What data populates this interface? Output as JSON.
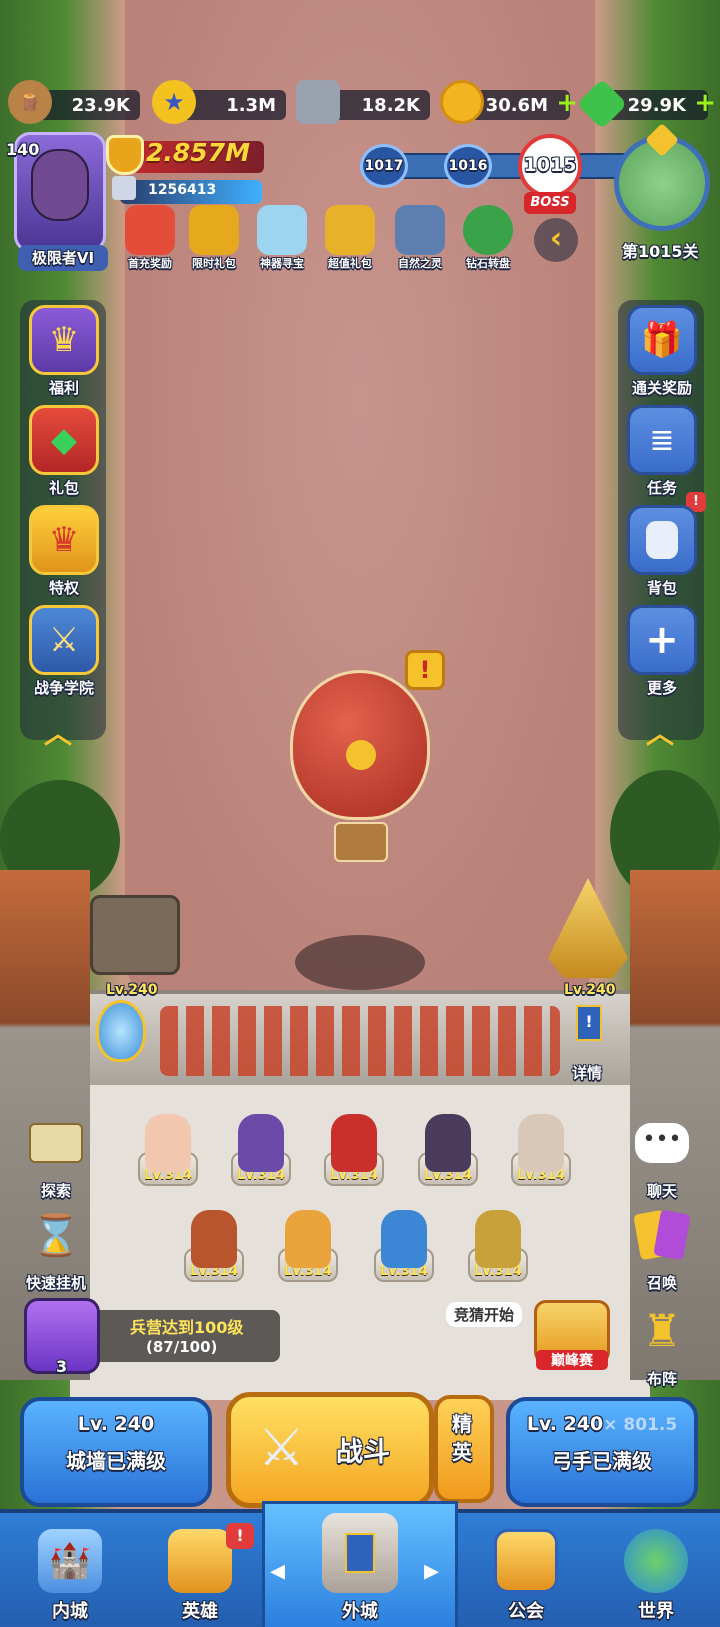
{
  "resources": [
    {
      "id": "wood",
      "value": "23.9K",
      "icon": "wood-log-icon",
      "color": "#b98246"
    },
    {
      "id": "medal",
      "value": "1.3M",
      "icon": "star-medal-icon",
      "color": "#f3c21f"
    },
    {
      "id": "iron",
      "value": "18.2K",
      "icon": "iron-ingot-icon",
      "color": "#9aa2b0"
    },
    {
      "id": "gold",
      "value": "30.6M",
      "icon": "gold-coin-icon",
      "color": "#f2b521"
    },
    {
      "id": "gem",
      "value": "29.9K",
      "icon": "green-gem-icon",
      "color": "#3fc24a"
    }
  ],
  "player": {
    "level": "140",
    "rank": "极限者VI",
    "power": "2.857M",
    "id": "1256413"
  },
  "stages": {
    "prev2": "1017",
    "prev1": "1016",
    "current": "1015",
    "boss": "BOSS",
    "stage_label": "第1015关"
  },
  "events": [
    "首充奖励",
    "限时礼包",
    "神器寻宝",
    "超值礼包",
    "自然之灵",
    "钻石转盘"
  ],
  "left_menu": [
    "福利",
    "礼包",
    "特权",
    "战争学院"
  ],
  "right_menu": [
    "通关奖励",
    "任务",
    "背包",
    "更多"
  ],
  "castle": {
    "left_tower_level": "Lv.240",
    "right_tower_level": "Lv.240",
    "details": "详情"
  },
  "heroes": [
    "Lv.314",
    "Lv.314",
    "Lv.314",
    "Lv.314",
    "Lv.314",
    "Lv.314",
    "Lv.314",
    "Lv.314",
    "Lv.314"
  ],
  "side_actions": {
    "explore": "探索",
    "quick_idle": "快速挂机",
    "chat": "聊天",
    "summon": "召唤",
    "formation": "布阵"
  },
  "barracks": {
    "text": "兵营达到100级",
    "progress": "(87/100)",
    "gift_count": "3"
  },
  "quiz": "竞猜开始",
  "peak": "巅峰赛",
  "wall": {
    "level": "Lv. 240",
    "status": "城墙已满级"
  },
  "battle": "战斗",
  "elite": "精英",
  "archer": {
    "level": "Lv. 240",
    "bonus": "× 801.5",
    "status": "弓手已满级"
  },
  "nav": [
    "内城",
    "英雄",
    "外城",
    "公会",
    "世界"
  ]
}
